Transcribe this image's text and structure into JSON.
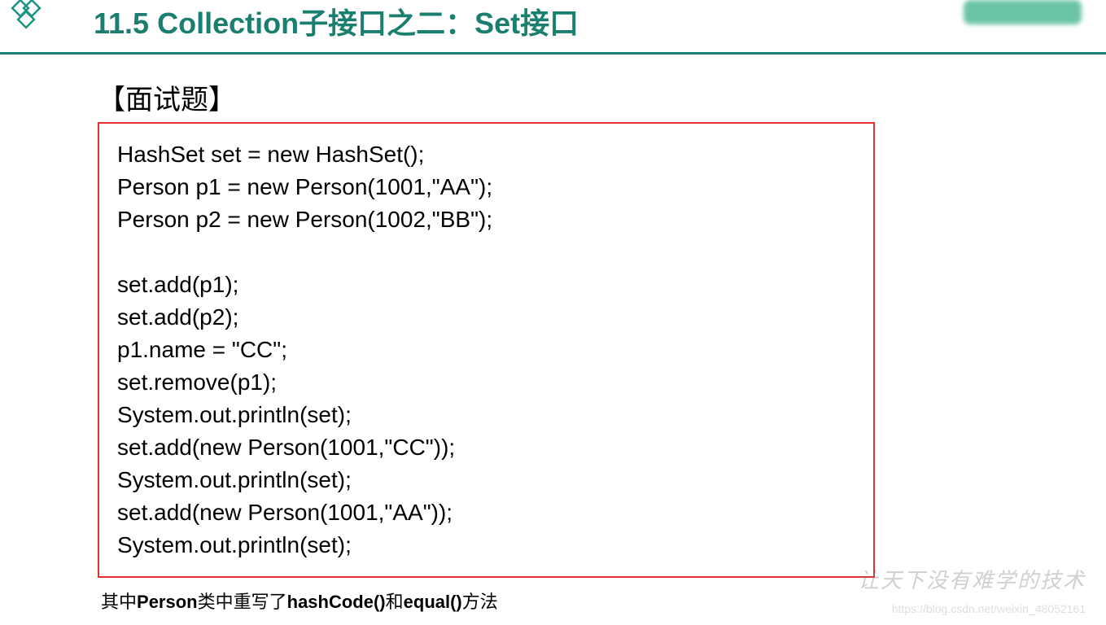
{
  "header": {
    "title": "11.5 Collection子接口之二：Set接口"
  },
  "section": {
    "title": "【面试题】"
  },
  "code": {
    "lines": [
      "HashSet set = new HashSet();",
      "Person p1 = new Person(1001,\"AA\");",
      "Person p2 = new Person(1002,\"BB\");",
      "",
      "set.add(p1);",
      "set.add(p2);",
      "p1.name = \"CC\";",
      "set.remove(p1);",
      "System.out.println(set);",
      "set.add(new Person(1001,\"CC\"));",
      "System.out.println(set);",
      "set.add(new Person(1001,\"AA\"));",
      "System.out.println(set);"
    ]
  },
  "footer": {
    "note_prefix": "其中",
    "note_bold1": "Person",
    "note_mid1": "类中重写了",
    "note_bold2": "hashCode()",
    "note_mid2": "和",
    "note_bold3": "equal()",
    "note_suffix": "方法"
  },
  "watermark": {
    "text": "让天下没有难学的技术",
    "url": "https://blog.csdn.net/weixin_48052161"
  }
}
